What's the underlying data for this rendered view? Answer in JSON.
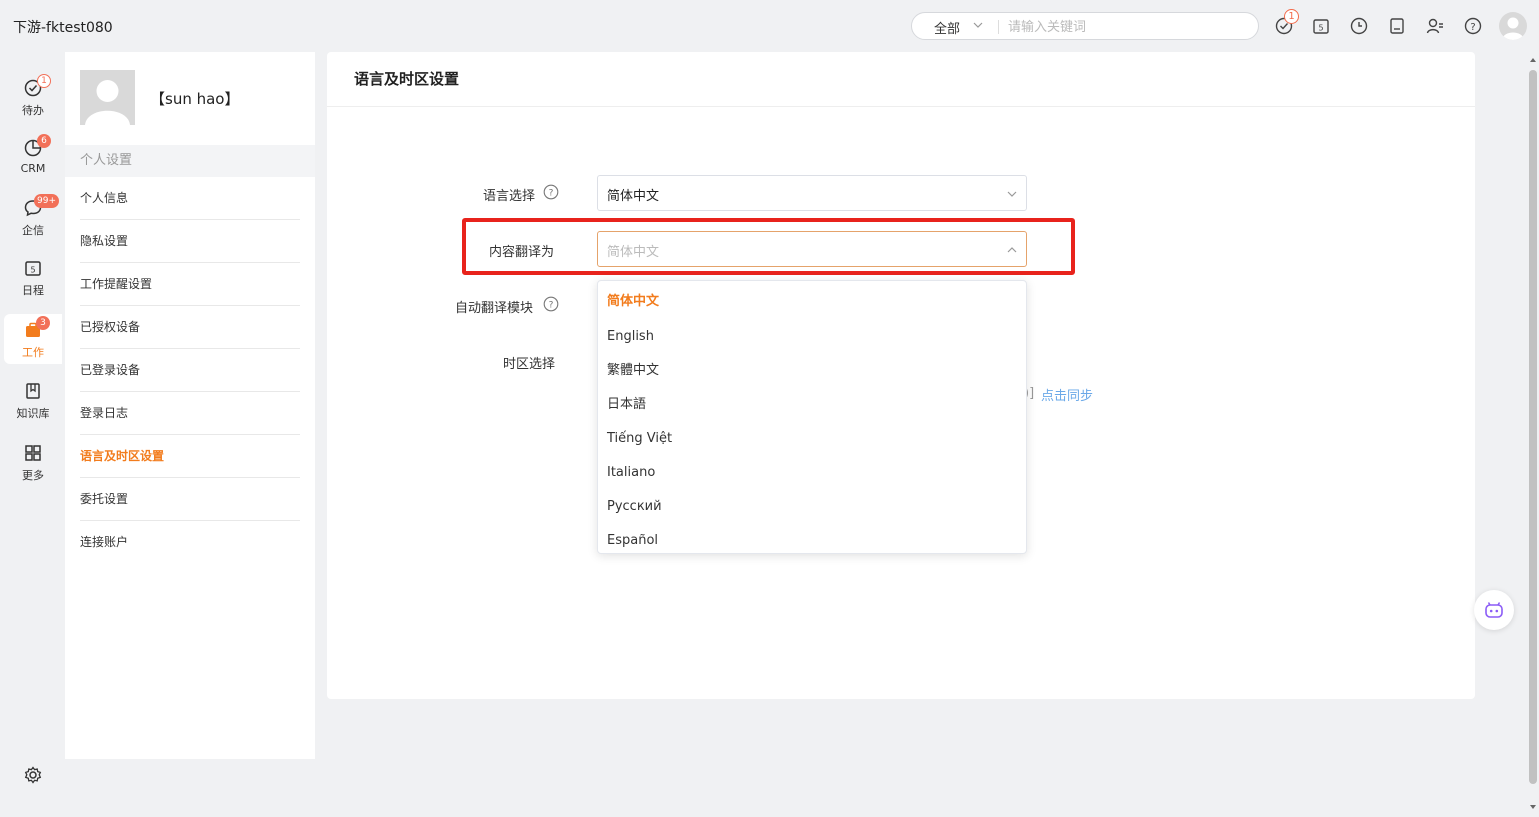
{
  "app": {
    "title": "下游-fktest080"
  },
  "search": {
    "scope": "全部",
    "placeholder": "请输入关键词"
  },
  "topbar": {
    "todo_badge": "1"
  },
  "rail": {
    "items": [
      {
        "label": "待办",
        "icon": "check-circle-icon",
        "badge": "1"
      },
      {
        "label": "CRM",
        "icon": "crm-pie-icon",
        "badge": "6"
      },
      {
        "label": "企信",
        "icon": "chat-bubble-icon",
        "badge": "99+"
      },
      {
        "label": "日程",
        "icon": "calendar-icon",
        "badge": ""
      },
      {
        "label": "工作",
        "icon": "briefcase-icon",
        "badge": "3"
      },
      {
        "label": "知识库",
        "icon": "book-icon",
        "badge": ""
      },
      {
        "label": "更多",
        "icon": "grid-icon",
        "badge": ""
      }
    ]
  },
  "user": {
    "name": "【sun hao】"
  },
  "menu": {
    "section": "个人设置",
    "items": [
      {
        "label": "个人信息"
      },
      {
        "label": "隐私设置"
      },
      {
        "label": "工作提醒设置"
      },
      {
        "label": "已授权设备"
      },
      {
        "label": "已登录设备"
      },
      {
        "label": "登录日志"
      },
      {
        "label": "语言及时区设置"
      },
      {
        "label": "委托设置"
      },
      {
        "label": "连接账户"
      }
    ]
  },
  "main": {
    "title": "语言及时区设置",
    "language_label": "语言选择",
    "language_value": "简体中文",
    "translate_label": "内容翻译为",
    "translate_placeholder": "简体中文",
    "auto_translate_label": "自动翻译模块",
    "timezone_label": "时区选择",
    "partial_bracket": ")]",
    "sync_link": "点击同步"
  },
  "dropdown": {
    "options": [
      "简体中文",
      "English",
      "繁體中文",
      "日本語",
      "Tiếng Việt",
      "Italiano",
      "Русский",
      "Español"
    ],
    "selected": "简体中文"
  },
  "colors": {
    "accent": "#f27c1d",
    "highlight": "#e8231c",
    "link": "#6aa8e8",
    "badge": "#f27058"
  }
}
